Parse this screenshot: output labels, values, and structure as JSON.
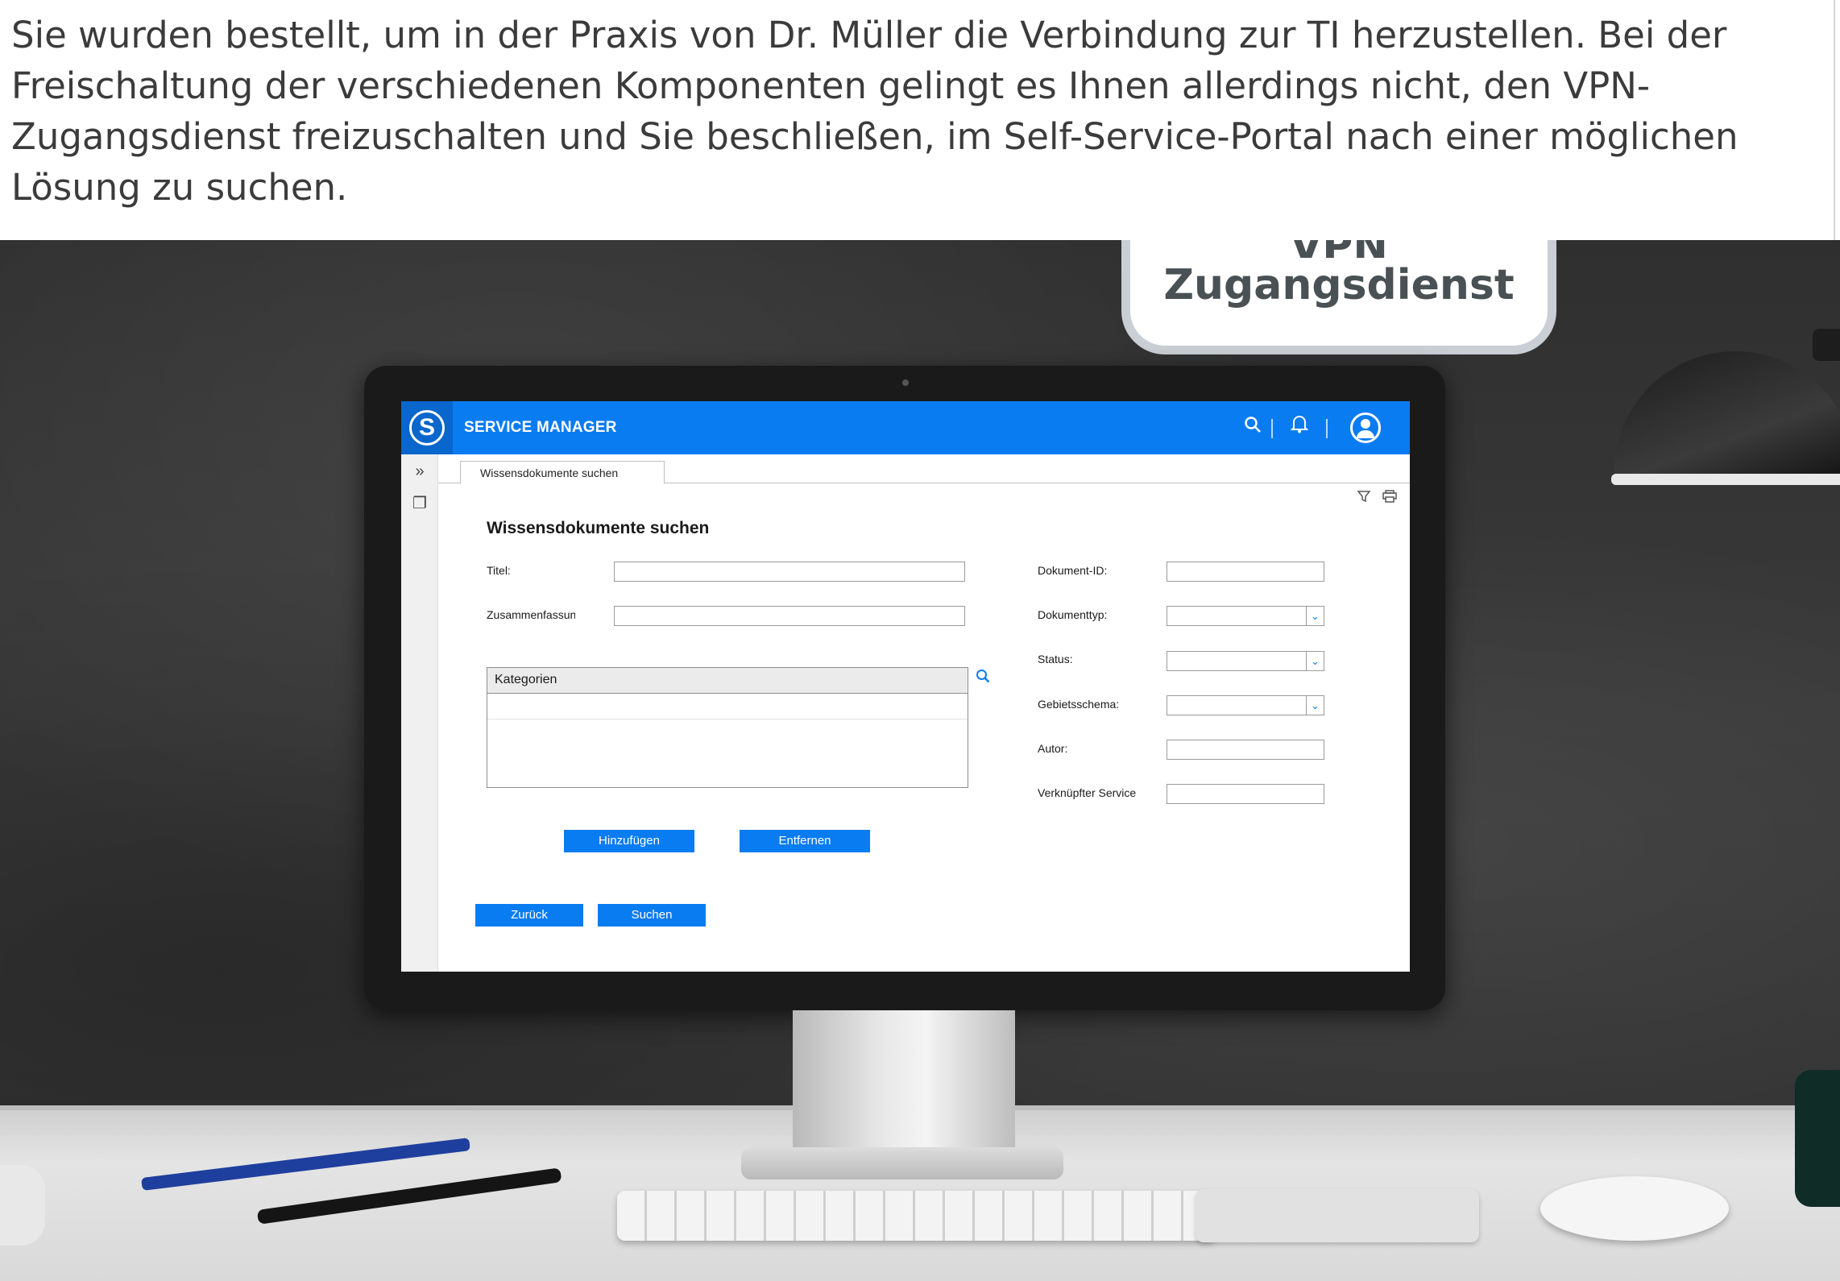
{
  "intro": {
    "text": "Sie wurden bestellt, um in der Praxis von Dr. Müller die Verbindung zur TI herzustellen. Bei der Freischaltung der verschiedenen Komponenten gelingt es Ihnen allerdings nicht, den VPN-Zugangsdienst freizuschalten und Sie beschließen, im Self-Service-Portal nach einer möglichen Lösung zu suchen."
  },
  "badge": {
    "line1": "VPN",
    "line2": "Zugangsdienst"
  },
  "app": {
    "logo_letter": "S",
    "title": "SERVICE MANAGER",
    "icons": {
      "search": "search-icon",
      "bell": "bell-icon",
      "user": "user-icon"
    },
    "accent": "#0a7cf1"
  },
  "sidebar": {
    "expand": "»",
    "windows": "❐"
  },
  "tab": {
    "label": "Wissensdokumente suchen"
  },
  "form": {
    "title": "Wissensdokumente suchen",
    "titel_label": "Titel:",
    "titel_value": "",
    "zusammenfassung_label": "Zusammenfassung:",
    "zusammenfassung_value": "",
    "kategorien_label": "Kategorien",
    "dokument_id_label": "Dokument-ID:",
    "dokument_id_value": "",
    "dokumenttyp_label": "Dokumenttyp:",
    "status_label": "Status:",
    "gebietsschema_label": "Gebietsschema:",
    "autor_label": "Autor:",
    "autor_value": "",
    "verknuepfter_service_label": "Verknüpfter Service",
    "verknuepfter_service_value": ""
  },
  "buttons": {
    "hinzufuegen": "Hinzufügen",
    "entfernen": "Entfernen",
    "zurueck": "Zurück",
    "suchen": "Suchen"
  }
}
